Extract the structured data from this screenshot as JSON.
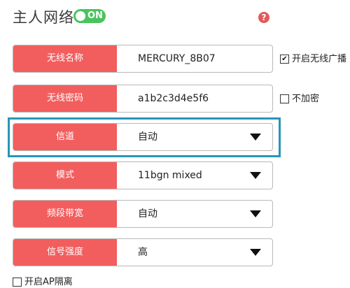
{
  "header": {
    "title": "主人网络",
    "toggle_label": "ON",
    "help_glyph": "?"
  },
  "rows": [
    {
      "label": "无线名称",
      "value": "MERCURY_8B07",
      "type": "text"
    },
    {
      "label": "无线密码",
      "value": "a1b2c3d4e5f6",
      "type": "text"
    },
    {
      "label": "信道",
      "value": "自动",
      "type": "select"
    },
    {
      "label": "模式",
      "value": "11bgn mixed",
      "type": "select"
    },
    {
      "label": "频段带宽",
      "value": "自动",
      "type": "select"
    },
    {
      "label": "信号强度",
      "value": "高",
      "type": "select"
    }
  ],
  "options": {
    "enable_broadcast": {
      "label": "开启无线广播",
      "checked": true,
      "mark": "✔"
    },
    "no_encryption": {
      "label": "不加密",
      "checked": false
    },
    "ap_isolation": {
      "label": "开启AP隔离",
      "checked": false
    }
  },
  "colors": {
    "label_bg": "#f25e5e",
    "toggle_on": "#49c45d",
    "highlight_border": "#2a95b8",
    "help_icon": "#e35a5a"
  },
  "icons": {
    "help": "help-icon",
    "dropdown": "triangle-down-icon",
    "checkbox": "checkbox-icon"
  }
}
